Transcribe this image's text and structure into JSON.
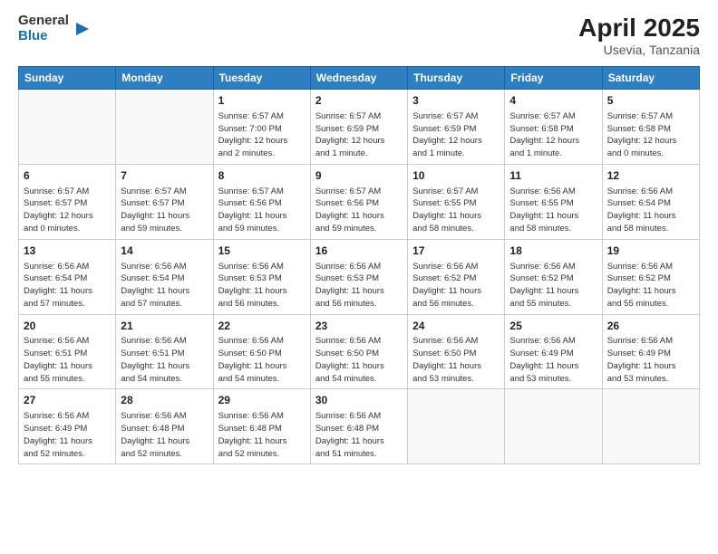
{
  "header": {
    "logo_general": "General",
    "logo_blue": "Blue",
    "title": "April 2025",
    "location": "Usevia, Tanzania"
  },
  "calendar": {
    "days_of_week": [
      "Sunday",
      "Monday",
      "Tuesday",
      "Wednesday",
      "Thursday",
      "Friday",
      "Saturday"
    ],
    "weeks": [
      [
        {
          "day": "",
          "info": ""
        },
        {
          "day": "",
          "info": ""
        },
        {
          "day": "1",
          "info": "Sunrise: 6:57 AM\nSunset: 7:00 PM\nDaylight: 12 hours\nand 2 minutes."
        },
        {
          "day": "2",
          "info": "Sunrise: 6:57 AM\nSunset: 6:59 PM\nDaylight: 12 hours\nand 1 minute."
        },
        {
          "day": "3",
          "info": "Sunrise: 6:57 AM\nSunset: 6:59 PM\nDaylight: 12 hours\nand 1 minute."
        },
        {
          "day": "4",
          "info": "Sunrise: 6:57 AM\nSunset: 6:58 PM\nDaylight: 12 hours\nand 1 minute."
        },
        {
          "day": "5",
          "info": "Sunrise: 6:57 AM\nSunset: 6:58 PM\nDaylight: 12 hours\nand 0 minutes."
        }
      ],
      [
        {
          "day": "6",
          "info": "Sunrise: 6:57 AM\nSunset: 6:57 PM\nDaylight: 12 hours\nand 0 minutes."
        },
        {
          "day": "7",
          "info": "Sunrise: 6:57 AM\nSunset: 6:57 PM\nDaylight: 11 hours\nand 59 minutes."
        },
        {
          "day": "8",
          "info": "Sunrise: 6:57 AM\nSunset: 6:56 PM\nDaylight: 11 hours\nand 59 minutes."
        },
        {
          "day": "9",
          "info": "Sunrise: 6:57 AM\nSunset: 6:56 PM\nDaylight: 11 hours\nand 59 minutes."
        },
        {
          "day": "10",
          "info": "Sunrise: 6:57 AM\nSunset: 6:55 PM\nDaylight: 11 hours\nand 58 minutes."
        },
        {
          "day": "11",
          "info": "Sunrise: 6:56 AM\nSunset: 6:55 PM\nDaylight: 11 hours\nand 58 minutes."
        },
        {
          "day": "12",
          "info": "Sunrise: 6:56 AM\nSunset: 6:54 PM\nDaylight: 11 hours\nand 58 minutes."
        }
      ],
      [
        {
          "day": "13",
          "info": "Sunrise: 6:56 AM\nSunset: 6:54 PM\nDaylight: 11 hours\nand 57 minutes."
        },
        {
          "day": "14",
          "info": "Sunrise: 6:56 AM\nSunset: 6:54 PM\nDaylight: 11 hours\nand 57 minutes."
        },
        {
          "day": "15",
          "info": "Sunrise: 6:56 AM\nSunset: 6:53 PM\nDaylight: 11 hours\nand 56 minutes."
        },
        {
          "day": "16",
          "info": "Sunrise: 6:56 AM\nSunset: 6:53 PM\nDaylight: 11 hours\nand 56 minutes."
        },
        {
          "day": "17",
          "info": "Sunrise: 6:56 AM\nSunset: 6:52 PM\nDaylight: 11 hours\nand 56 minutes."
        },
        {
          "day": "18",
          "info": "Sunrise: 6:56 AM\nSunset: 6:52 PM\nDaylight: 11 hours\nand 55 minutes."
        },
        {
          "day": "19",
          "info": "Sunrise: 6:56 AM\nSunset: 6:52 PM\nDaylight: 11 hours\nand 55 minutes."
        }
      ],
      [
        {
          "day": "20",
          "info": "Sunrise: 6:56 AM\nSunset: 6:51 PM\nDaylight: 11 hours\nand 55 minutes."
        },
        {
          "day": "21",
          "info": "Sunrise: 6:56 AM\nSunset: 6:51 PM\nDaylight: 11 hours\nand 54 minutes."
        },
        {
          "day": "22",
          "info": "Sunrise: 6:56 AM\nSunset: 6:50 PM\nDaylight: 11 hours\nand 54 minutes."
        },
        {
          "day": "23",
          "info": "Sunrise: 6:56 AM\nSunset: 6:50 PM\nDaylight: 11 hours\nand 54 minutes."
        },
        {
          "day": "24",
          "info": "Sunrise: 6:56 AM\nSunset: 6:50 PM\nDaylight: 11 hours\nand 53 minutes."
        },
        {
          "day": "25",
          "info": "Sunrise: 6:56 AM\nSunset: 6:49 PM\nDaylight: 11 hours\nand 53 minutes."
        },
        {
          "day": "26",
          "info": "Sunrise: 6:56 AM\nSunset: 6:49 PM\nDaylight: 11 hours\nand 53 minutes."
        }
      ],
      [
        {
          "day": "27",
          "info": "Sunrise: 6:56 AM\nSunset: 6:49 PM\nDaylight: 11 hours\nand 52 minutes."
        },
        {
          "day": "28",
          "info": "Sunrise: 6:56 AM\nSunset: 6:48 PM\nDaylight: 11 hours\nand 52 minutes."
        },
        {
          "day": "29",
          "info": "Sunrise: 6:56 AM\nSunset: 6:48 PM\nDaylight: 11 hours\nand 52 minutes."
        },
        {
          "day": "30",
          "info": "Sunrise: 6:56 AM\nSunset: 6:48 PM\nDaylight: 11 hours\nand 51 minutes."
        },
        {
          "day": "",
          "info": ""
        },
        {
          "day": "",
          "info": ""
        },
        {
          "day": "",
          "info": ""
        }
      ]
    ]
  }
}
